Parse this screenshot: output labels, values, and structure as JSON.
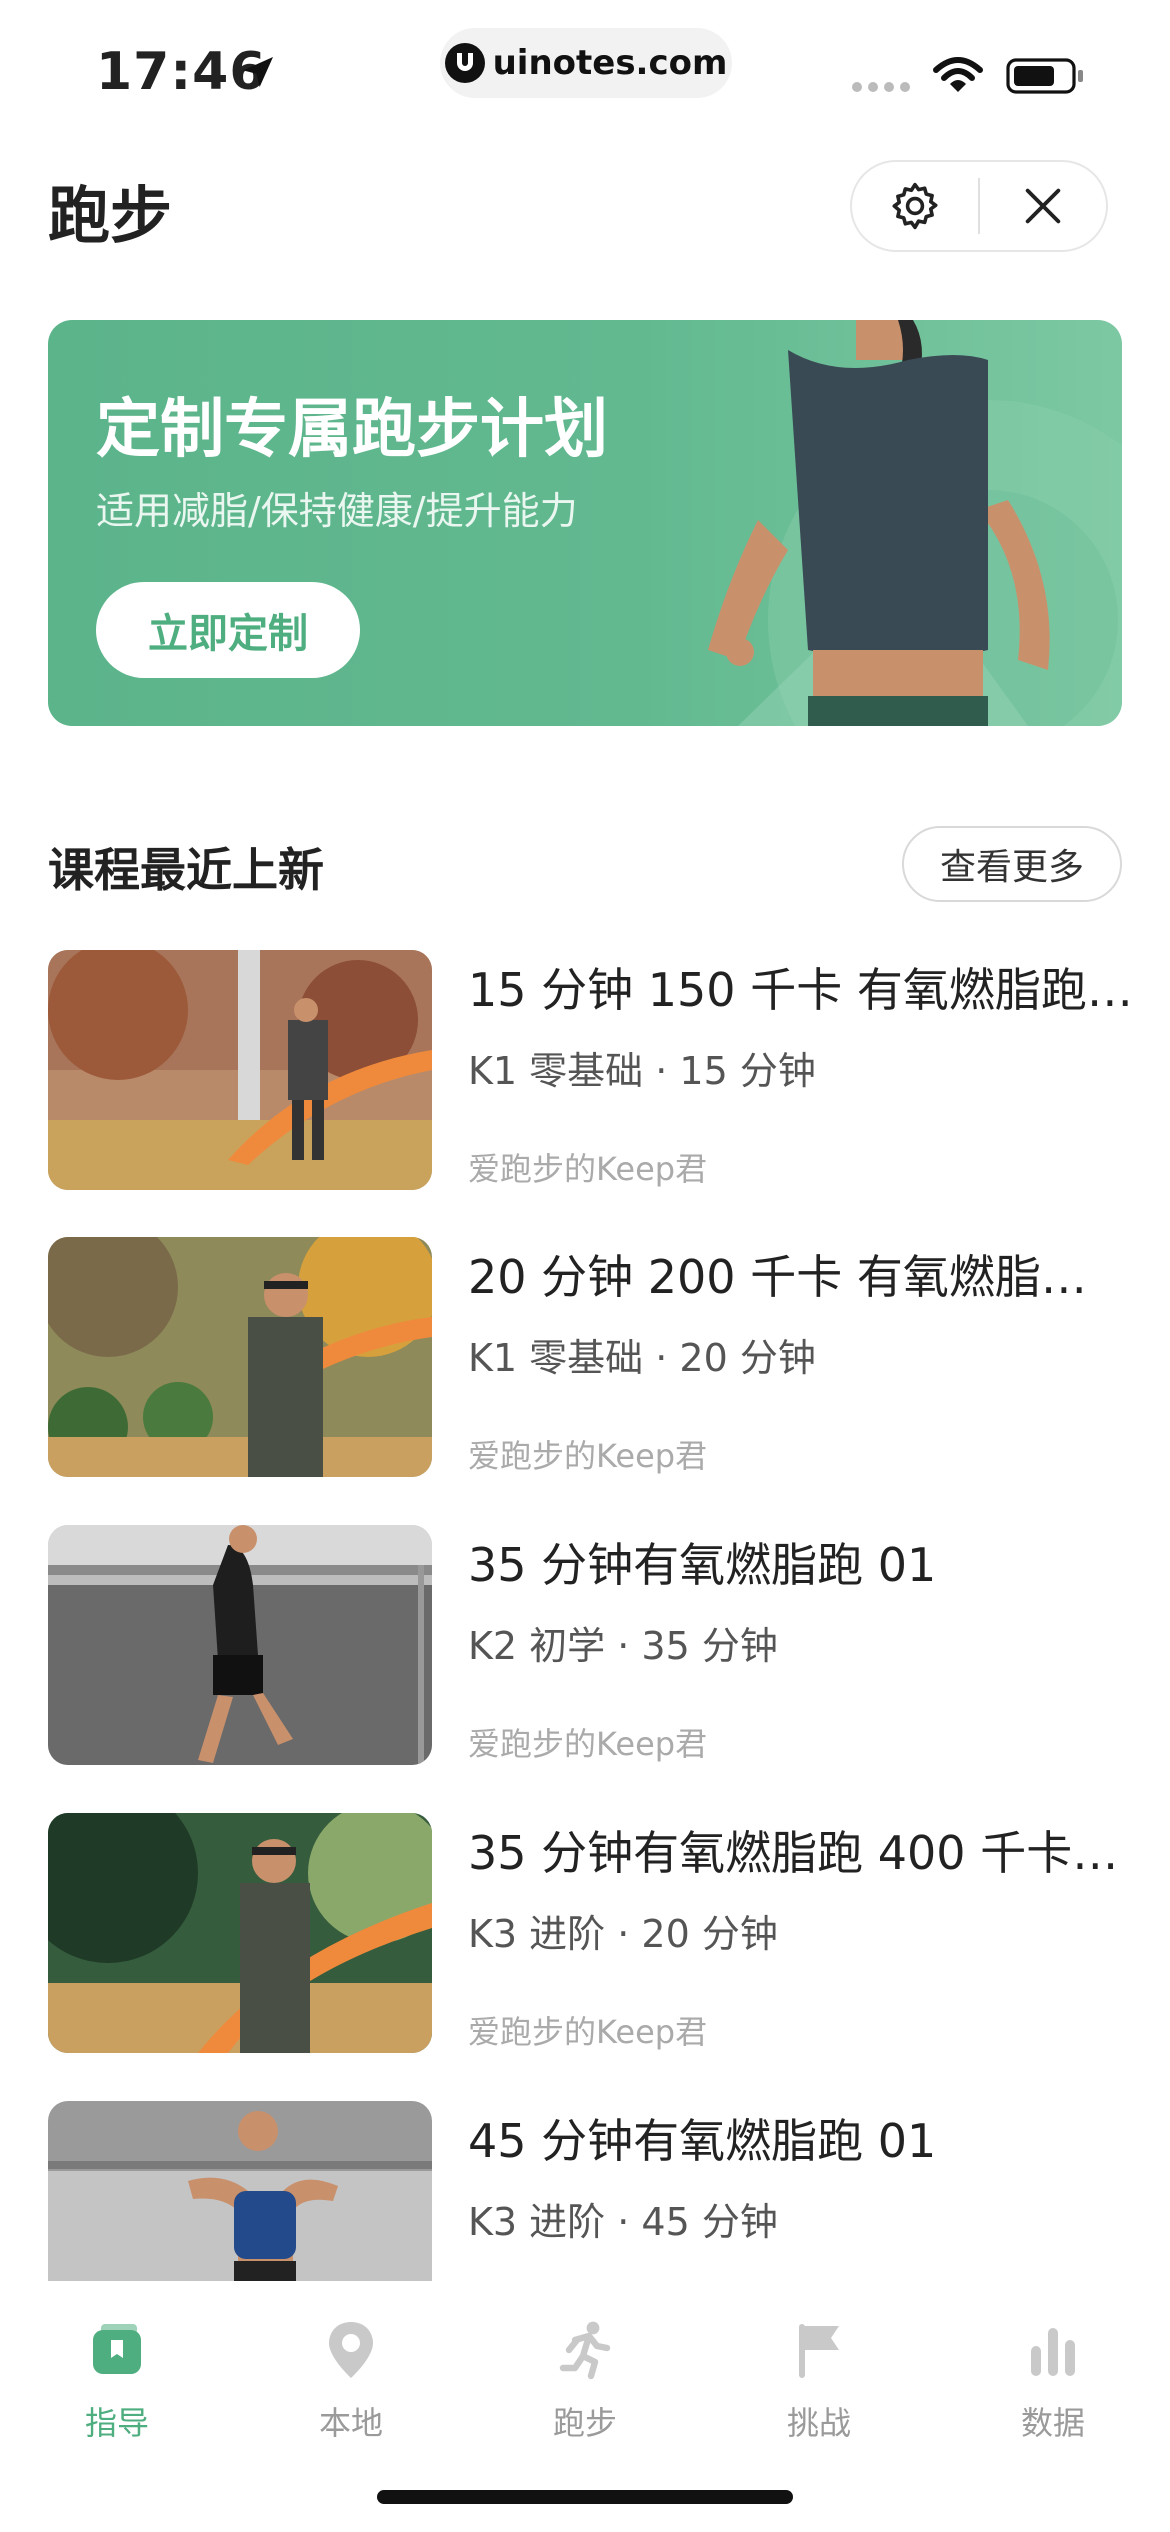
{
  "status_bar": {
    "time": "17:46",
    "url": "uinotes.com"
  },
  "header": {
    "title": "跑步",
    "settings_icon": "gear-icon",
    "close_icon": "close-icon"
  },
  "banner": {
    "title": "定制专属跑步计划",
    "subtitle": "适用减脂/保持健康/提升能力",
    "button_label": "立即定制"
  },
  "section": {
    "title": "课程最近上新",
    "more_label": "查看更多"
  },
  "courses": [
    {
      "title": "15 分钟 150 千卡 有氧燃脂跑…",
      "meta": "K1 零基础 · 15 分钟",
      "author": "爱跑步的Keep君"
    },
    {
      "title": "20 分钟 200 千卡 有氧燃脂…",
      "meta": "K1 零基础 · 20 分钟",
      "author": "爱跑步的Keep君"
    },
    {
      "title": "35 分钟有氧燃脂跑 01",
      "meta": "K2 初学 · 35 分钟",
      "author": "爱跑步的Keep君"
    },
    {
      "title": "35 分钟有氧燃脂跑 400 千卡…",
      "meta": "K3 进阶 · 20 分钟",
      "author": "爱跑步的Keep君"
    },
    {
      "title": "45 分钟有氧燃脂跑 01",
      "meta": "K3 进阶 · 45 分钟",
      "author": ""
    }
  ],
  "tabs": [
    {
      "label": "指导",
      "icon": "guide-icon",
      "active": true
    },
    {
      "label": "本地",
      "icon": "location-pin-icon",
      "active": false
    },
    {
      "label": "跑步",
      "icon": "runner-icon",
      "active": false
    },
    {
      "label": "挑战",
      "icon": "flag-icon",
      "active": false
    },
    {
      "label": "数据",
      "icon": "bar-chart-icon",
      "active": false
    }
  ],
  "colors": {
    "accent": "#4fae80",
    "banner": "#5cb48b",
    "inactive": "#9a9a9a"
  }
}
